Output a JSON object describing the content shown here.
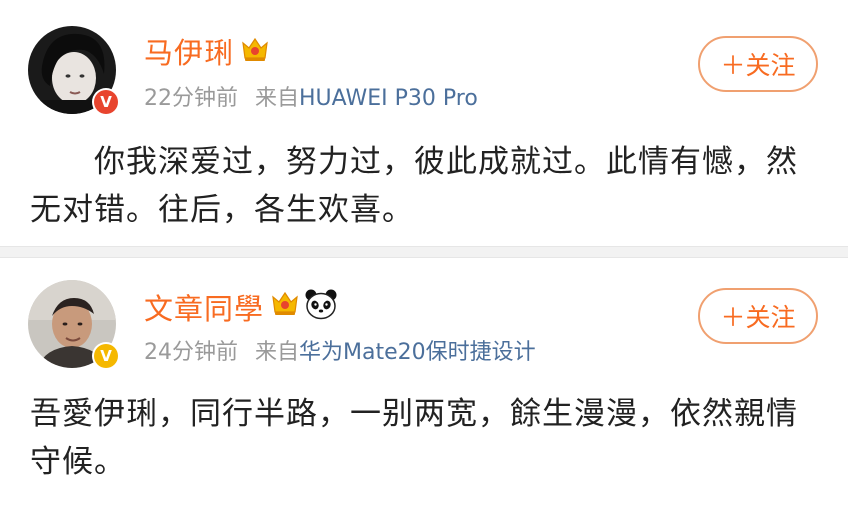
{
  "posts": [
    {
      "username": "马伊琍",
      "time": "22分钟前",
      "source_prefix": "来自",
      "device": "HUAWEI P30 Pro",
      "follow_label": "＋关注",
      "content": "你我深爱过，努力过，彼此成就过。此情有憾，然无对错。往后，各生欢喜。",
      "verified_badge": "red-v-badge",
      "badge_letter": "V",
      "badge_color": "#e8442e"
    },
    {
      "username": "文章同學",
      "time": "24分钟前",
      "source_prefix": "来自",
      "device": "华为Mate20保时捷设计",
      "follow_label": "＋关注",
      "content": "吾愛伊琍，同行半路，一别两宽，餘生漫漫，依然親情守候。",
      "verified_badge": "gold-v-badge",
      "badge_letter": "V",
      "badge_color": "#f5b800"
    }
  ],
  "colors": {
    "username": "#f86b21",
    "follow_border": "#f0a070",
    "meta_gray": "#9a9a9a",
    "device_blue": "#4b6f9b",
    "body_text": "#222222",
    "separator": "#f2f2f2"
  }
}
